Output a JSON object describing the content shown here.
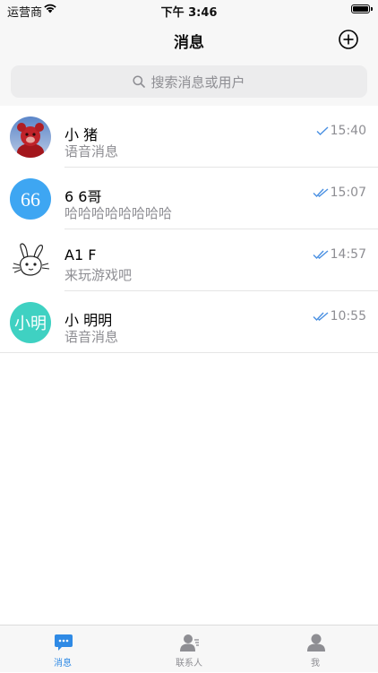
{
  "status_bar": {
    "carrier": "运营商",
    "time": "下午 3:46"
  },
  "header": {
    "title": "消息",
    "add_icon": "plus-circle-icon"
  },
  "search": {
    "placeholder": "搜索消息或用户",
    "icon": "search-icon"
  },
  "chats": [
    {
      "name": "小 猪",
      "preview": "语音消息",
      "time": "15:40",
      "read_status": "sent",
      "avatar": "red-bear-photo"
    },
    {
      "name": "6 6哥",
      "preview": "哈哈哈哈哈哈哈哈",
      "time": "15:07",
      "read_status": "read",
      "avatar_text": "66",
      "avatar_color": "#3ea6f2"
    },
    {
      "name": "A1 F",
      "preview": "来玩游戏吧",
      "time": "14:57",
      "read_status": "read",
      "avatar": "rabbit-sketch"
    },
    {
      "name": "小 明明",
      "preview": "语音消息",
      "time": "10:55",
      "read_status": "read",
      "avatar_text": "小明",
      "avatar_color": "#3fd1c2"
    }
  ],
  "tab_bar": {
    "tabs": [
      {
        "label": "消息",
        "icon": "chat-bubble-icon",
        "active": true
      },
      {
        "label": "联系人",
        "icon": "contacts-icon",
        "active": false
      },
      {
        "label": "我",
        "icon": "person-icon",
        "active": false
      }
    ]
  },
  "colors": {
    "accent": "#2f8ae5",
    "secondary_text": "#8e8e93",
    "check": "#4a90e2"
  }
}
